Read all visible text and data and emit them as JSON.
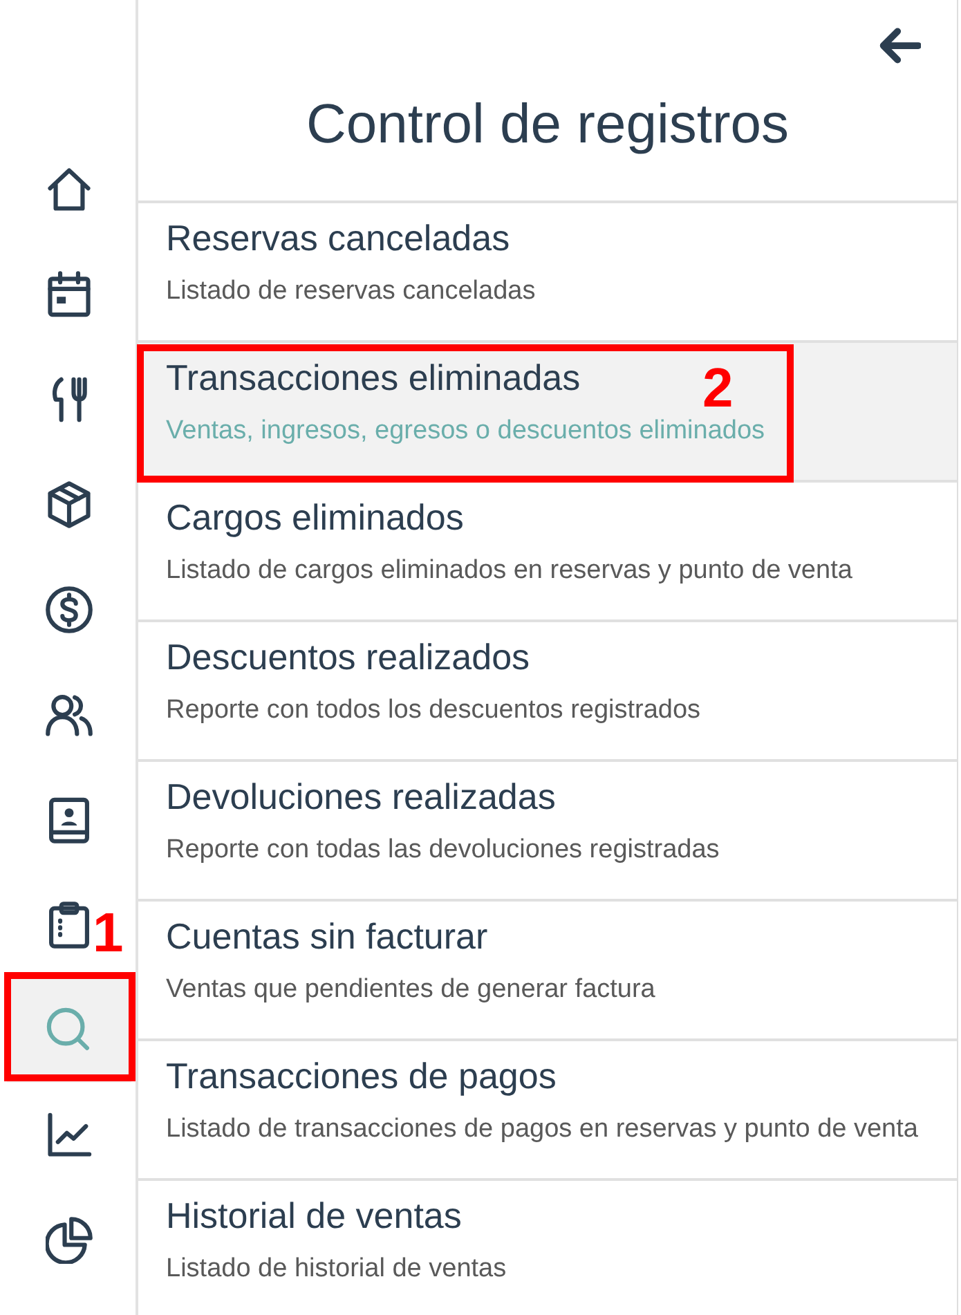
{
  "sidebar": {
    "items": [
      {
        "kind": "home",
        "selected": false
      },
      {
        "kind": "calendar",
        "selected": false
      },
      {
        "kind": "utensils",
        "selected": false
      },
      {
        "kind": "box",
        "selected": false
      },
      {
        "kind": "dollar",
        "selected": false
      },
      {
        "kind": "users",
        "selected": false
      },
      {
        "kind": "contact-book",
        "selected": false
      },
      {
        "kind": "clipboard",
        "selected": false
      },
      {
        "kind": "search",
        "selected": true,
        "callout": "1"
      },
      {
        "kind": "line-chart",
        "selected": false
      },
      {
        "kind": "pie-chart",
        "selected": false
      }
    ]
  },
  "panel": {
    "title": "Control de registros"
  },
  "records": [
    {
      "title": "Reservas canceladas",
      "description": "Listado de reservas canceladas",
      "selected": false
    },
    {
      "title": "Transacciones eliminadas",
      "description": "Ventas, ingresos, egresos o descuentos eliminados",
      "selected": true,
      "callout": "2"
    },
    {
      "title": "Cargos eliminados",
      "description": "Listado de cargos eliminados en reservas y punto de venta",
      "selected": false
    },
    {
      "title": "Descuentos realizados",
      "description": "Reporte con todos los descuentos registrados",
      "selected": false
    },
    {
      "title": "Devoluciones realizadas",
      "description": "Reporte con todas las devoluciones registradas",
      "selected": false
    },
    {
      "title": "Cuentas sin facturar",
      "description": "Ventas que pendientes de generar factura",
      "selected": false
    },
    {
      "title": "Transacciones de pagos",
      "description": "Listado de transacciones de pagos en reservas y punto de venta",
      "selected": false
    },
    {
      "title": "Historial de ventas",
      "description": "Listado de historial de ventas",
      "selected": false
    }
  ]
}
